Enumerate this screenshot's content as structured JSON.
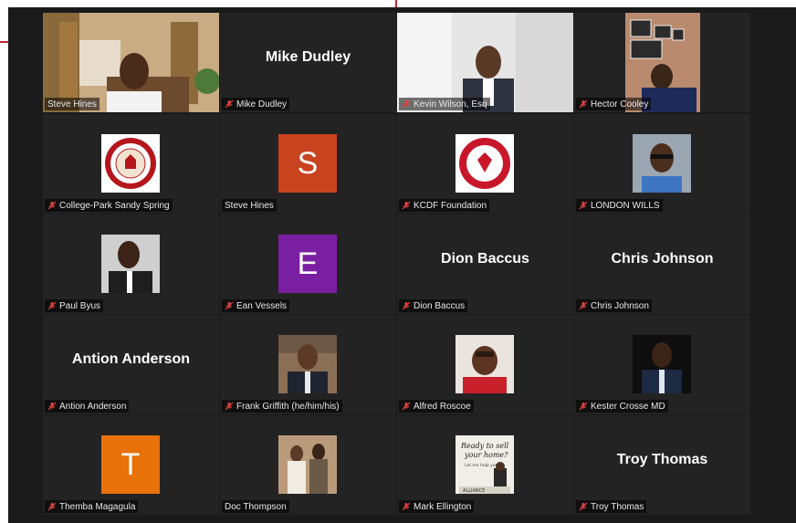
{
  "colors": {
    "active_border": "#d6d63a",
    "mute_icon": "#e0433f",
    "tile_bg": "#232323",
    "stage_bg": "#1a1a1a"
  },
  "participants": [
    {
      "name": "Steve Hines",
      "display": "video",
      "muted": false,
      "active": true
    },
    {
      "name": "Mike Dudley",
      "display": "name",
      "muted": true
    },
    {
      "name": "Kevin Wilson, Esq",
      "display": "video",
      "muted": true
    },
    {
      "name": "Hector Cooley",
      "display": "video",
      "muted": true
    },
    {
      "name": "College-Park Sandy Spring",
      "display": "logo",
      "muted": true
    },
    {
      "name": "Steve Hines",
      "display": "letter",
      "letter": "S",
      "letter_color": "#c8431e",
      "muted": false
    },
    {
      "name": "KCDF Foundation",
      "display": "logo",
      "muted": true
    },
    {
      "name": "LONDON WILLS",
      "display": "photo",
      "muted": true
    },
    {
      "name": "Paul Byus",
      "display": "photo",
      "muted": true
    },
    {
      "name": "Ean Vessels",
      "display": "letter",
      "letter": "E",
      "letter_color": "#7b1fa2",
      "muted": true
    },
    {
      "name": "Dion Baccus",
      "display": "name",
      "muted": true
    },
    {
      "name": "Chris Johnson",
      "display": "name",
      "muted": true
    },
    {
      "name": "Antion Anderson",
      "display": "name",
      "muted": true
    },
    {
      "name": "Frank Griffith (he/him/his)",
      "display": "photo",
      "muted": true
    },
    {
      "name": "Alfred Roscoe",
      "display": "photo",
      "muted": true
    },
    {
      "name": "Kester Crosse MD",
      "display": "photo",
      "muted": true
    },
    {
      "name": "Themba Magagula",
      "display": "letter",
      "letter": "T",
      "letter_color": "#e8710a",
      "muted": true
    },
    {
      "name": "Doc Thompson",
      "display": "photo",
      "muted": false
    },
    {
      "name": "Mark Ellington",
      "display": "photo",
      "muted": true
    },
    {
      "name": "Troy Thomas",
      "display": "name",
      "muted": true
    }
  ],
  "logo_text": {
    "kcdf_line": "KAPPA COMMUNITY DEVELOPMENT FOUNDATION, INC",
    "realtor_line1": "Ready to sell",
    "realtor_line2": "your home?",
    "realtor_line3": "Let me help you!",
    "realtor_brand": "ALLIANCE"
  }
}
